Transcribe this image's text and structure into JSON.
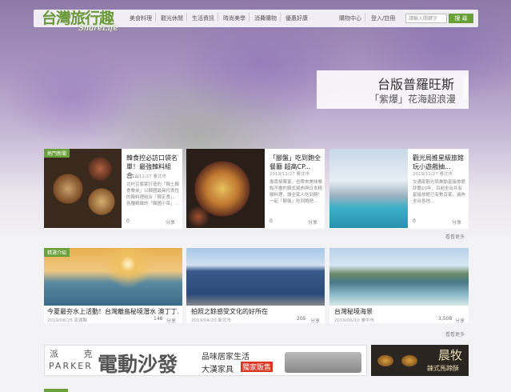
{
  "brand": {
    "name_zh": "台灣旅行趣",
    "name_en": "ShareLife"
  },
  "nav": {
    "items": [
      "美食料理",
      "觀光休閒",
      "生活資訊",
      "時尚美學",
      "消費購物",
      "優惠好康"
    ],
    "shop": "購物中心",
    "login": "登入/註冊"
  },
  "search": {
    "placeholder": "請輸入關鍵字",
    "button": "搜 尋"
  },
  "hero": {
    "title": "台版普羅旺斯",
    "subtitle": "「紫爆」花海超浪漫"
  },
  "row1": {
    "tag": "熱門新聞",
    "items": [
      {
        "title": "韓食控必訪口袋名單！最強韓料組合...",
        "meta": "2019/11/27 臺北市",
        "desc": "北村豆腐家打造的「韓土韓食餐桌」以韓國最具代表性的韓料理組合「韓定食」，各種精緻的「韓國小菜」...",
        "count": "0",
        "share": "分享"
      },
      {
        "title": "「腳盤」吃到飽全餐廳 超高CP...",
        "meta": "2019/11/27 臺北市",
        "desc": "壽喜燒饗宴，也帶來美味餐點不盡的韓式燒肉與日本精緻料理，讓全家人吃到飽！一起「腳盤」吃到飽吧...",
        "count": "0",
        "share": "分享"
      },
      {
        "title": "觀光局推星級旅館 玩小遊戲抽...",
        "meta": "2019/11/27 臺北市",
        "desc": "交通部觀光局推動星級旅館評鑑10年，目前全台共有星級旅館已有數百家，遍佈全台各地...",
        "count": "0",
        "share": "分享"
      }
    ],
    "more": "看看更多"
  },
  "row2": {
    "tag": "精選介紹",
    "items": [
      {
        "title": "今夏最夯水上活動！台灣離島秘境潛水 澳丁丁...",
        "meta": "2019/08/25 澎湖縣",
        "count": "148",
        "share": "分享"
      },
      {
        "title": "拍照之餘感受文化的好所在",
        "meta": "2019/04/20 新北市",
        "count": "205",
        "share": "分享"
      },
      {
        "title": "台灣秘境海景",
        "meta": "2019/06/10 臺中市",
        "count": "3,508",
        "share": "分享"
      }
    ],
    "more": "看看更多"
  },
  "ads": {
    "left": {
      "brand_zh": "派 克",
      "brand_en": "PARKER",
      "headline": "電動沙發",
      "line1": "品味居家生活",
      "line2": "大漢家具",
      "badge": "獨家販售"
    },
    "right": {
      "line1": "晨牧",
      "line2": "鍊式馬蹄酥"
    }
  },
  "colors": {
    "accent": "#6aa03a"
  }
}
